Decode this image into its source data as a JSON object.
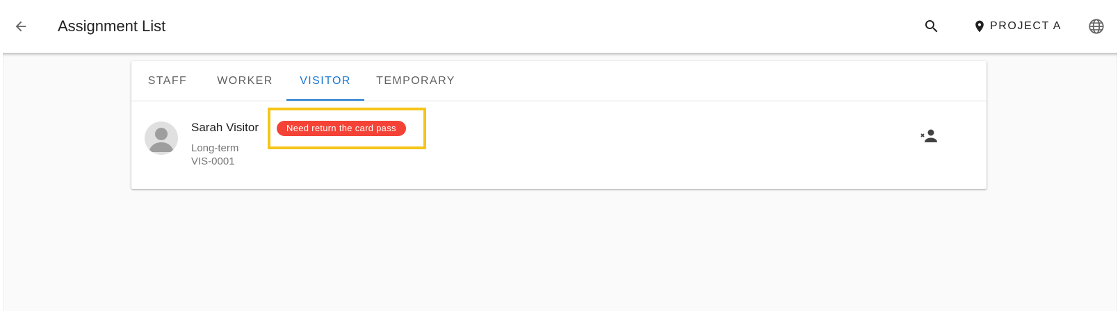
{
  "app_bar": {
    "title": "Assignment List",
    "back_icon": "arrow-back-icon",
    "search_icon": "search-icon",
    "project_icon": "location-pin-icon",
    "project_label": "PROJECT A",
    "language_icon": "globe-icon"
  },
  "tabs": [
    {
      "label": "STAFF",
      "active": false
    },
    {
      "label": "WORKER",
      "active": false
    },
    {
      "label": "VISITOR",
      "active": true
    },
    {
      "label": "TEMPORARY",
      "active": false
    }
  ],
  "list": [
    {
      "name": "Sarah Visitor",
      "badge": "Need return the card pass",
      "type": "Long-term",
      "id": "VIS-0001",
      "action_icon": "remove-person-icon"
    }
  ],
  "colors": {
    "accent": "#1976d2",
    "badge": "#f44336",
    "highlight": "#f5c518"
  }
}
